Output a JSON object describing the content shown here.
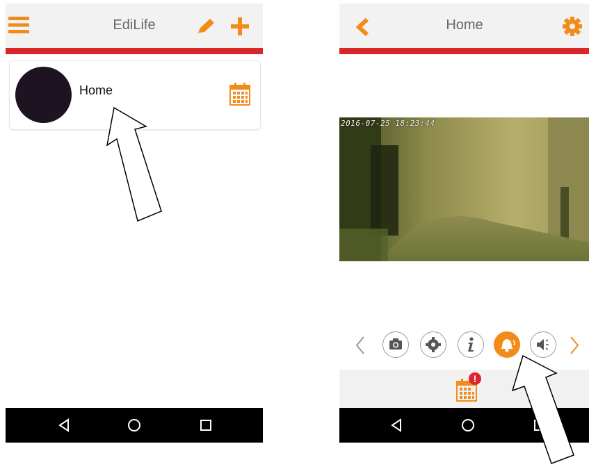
{
  "left_screen": {
    "header": {
      "title": "EdiLife",
      "menu_icon": "menu-icon",
      "edit_icon": "pencil-icon",
      "add_icon": "plus-icon"
    },
    "list": [
      {
        "label": "Home",
        "schedule_icon": "calendar-icon"
      }
    ]
  },
  "right_screen": {
    "header": {
      "title": "Home",
      "back_icon": "chevron-left-icon",
      "settings_icon": "gear-icon"
    },
    "video": {
      "timestamp": "2016-07-25  18:23:44"
    },
    "controls": [
      "camera-icon",
      "settings-icon",
      "info-icon",
      "bell-icon",
      "speaker-icon"
    ],
    "active_control": "bell-icon",
    "bottom": {
      "calendar_icon": "calendar-icon",
      "alert_badge": "!"
    }
  },
  "colors": {
    "accent": "#f38b1a",
    "header_line": "#d9262b",
    "nav_bar": "#000000"
  }
}
